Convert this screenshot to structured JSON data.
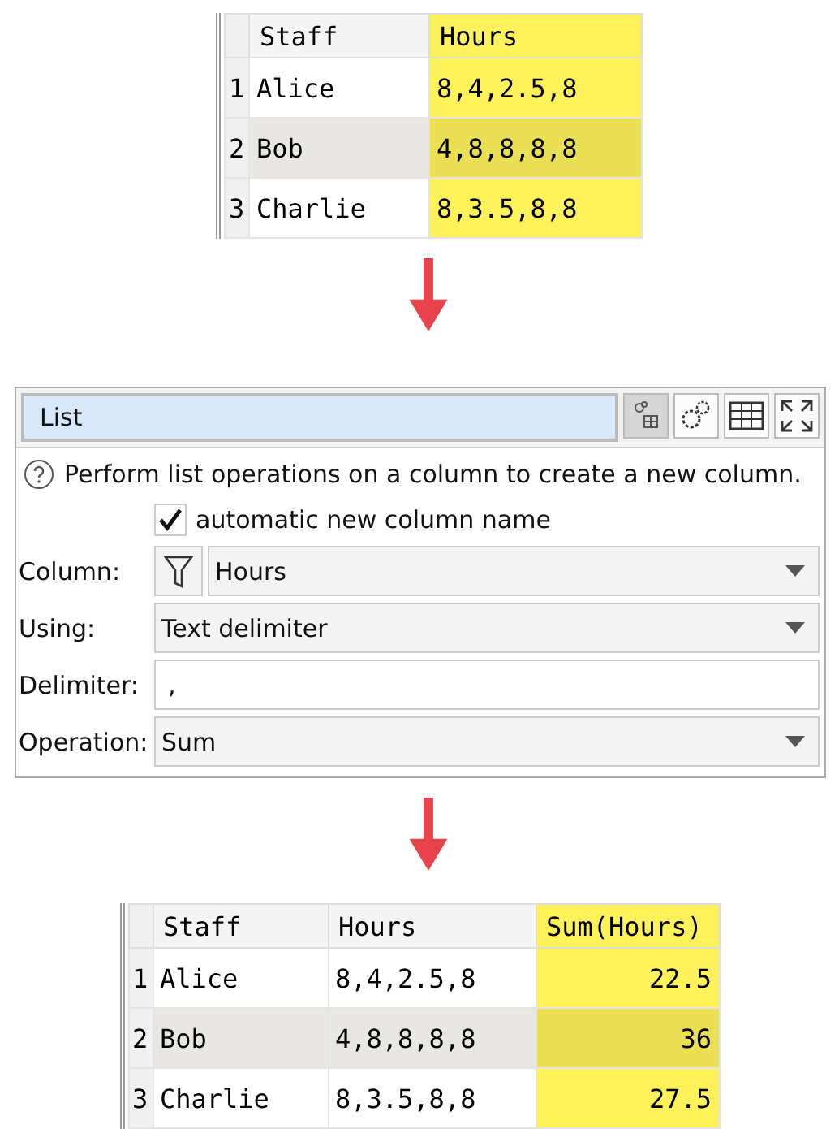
{
  "input_table": {
    "columns": [
      {
        "label": "Staff",
        "highlighted": false,
        "kind": "text"
      },
      {
        "label": "Hours",
        "highlighted": true,
        "kind": "text"
      }
    ],
    "rows": [
      {
        "index": "1",
        "cells": [
          "Alice",
          "8,4,2.5,8"
        ]
      },
      {
        "index": "2",
        "cells": [
          "Bob",
          "4,8,8,8,8"
        ]
      },
      {
        "index": "3",
        "cells": [
          "Charlie",
          "8,3.5,8,8"
        ]
      }
    ]
  },
  "panel": {
    "title": "List",
    "help": "Perform list operations on a column to create a new column.",
    "checkbox": {
      "label": "automatic new column name",
      "checked": true
    },
    "fields": [
      {
        "label": "Column:",
        "kind": "filter-dropdown",
        "value": "Hours"
      },
      {
        "label": "Using:",
        "kind": "dropdown",
        "value": "Text delimiter"
      },
      {
        "label": "Delimiter:",
        "kind": "text",
        "value": ","
      },
      {
        "label": "Operation:",
        "kind": "dropdown",
        "value": "Sum"
      }
    ]
  },
  "output_table": {
    "columns": [
      {
        "label": "Staff",
        "highlighted": false,
        "kind": "text"
      },
      {
        "label": "Hours",
        "highlighted": false,
        "kind": "text"
      },
      {
        "label": "Sum(Hours)",
        "highlighted": true,
        "kind": "number"
      }
    ],
    "rows": [
      {
        "index": "1",
        "cells": [
          "Alice",
          "8,4,2.5,8",
          "22.5"
        ]
      },
      {
        "index": "2",
        "cells": [
          "Bob",
          "4,8,8,8,8",
          "36"
        ]
      },
      {
        "index": "3",
        "cells": [
          "Charlie",
          "8,3.5,8,8",
          "27.5"
        ]
      }
    ]
  }
}
